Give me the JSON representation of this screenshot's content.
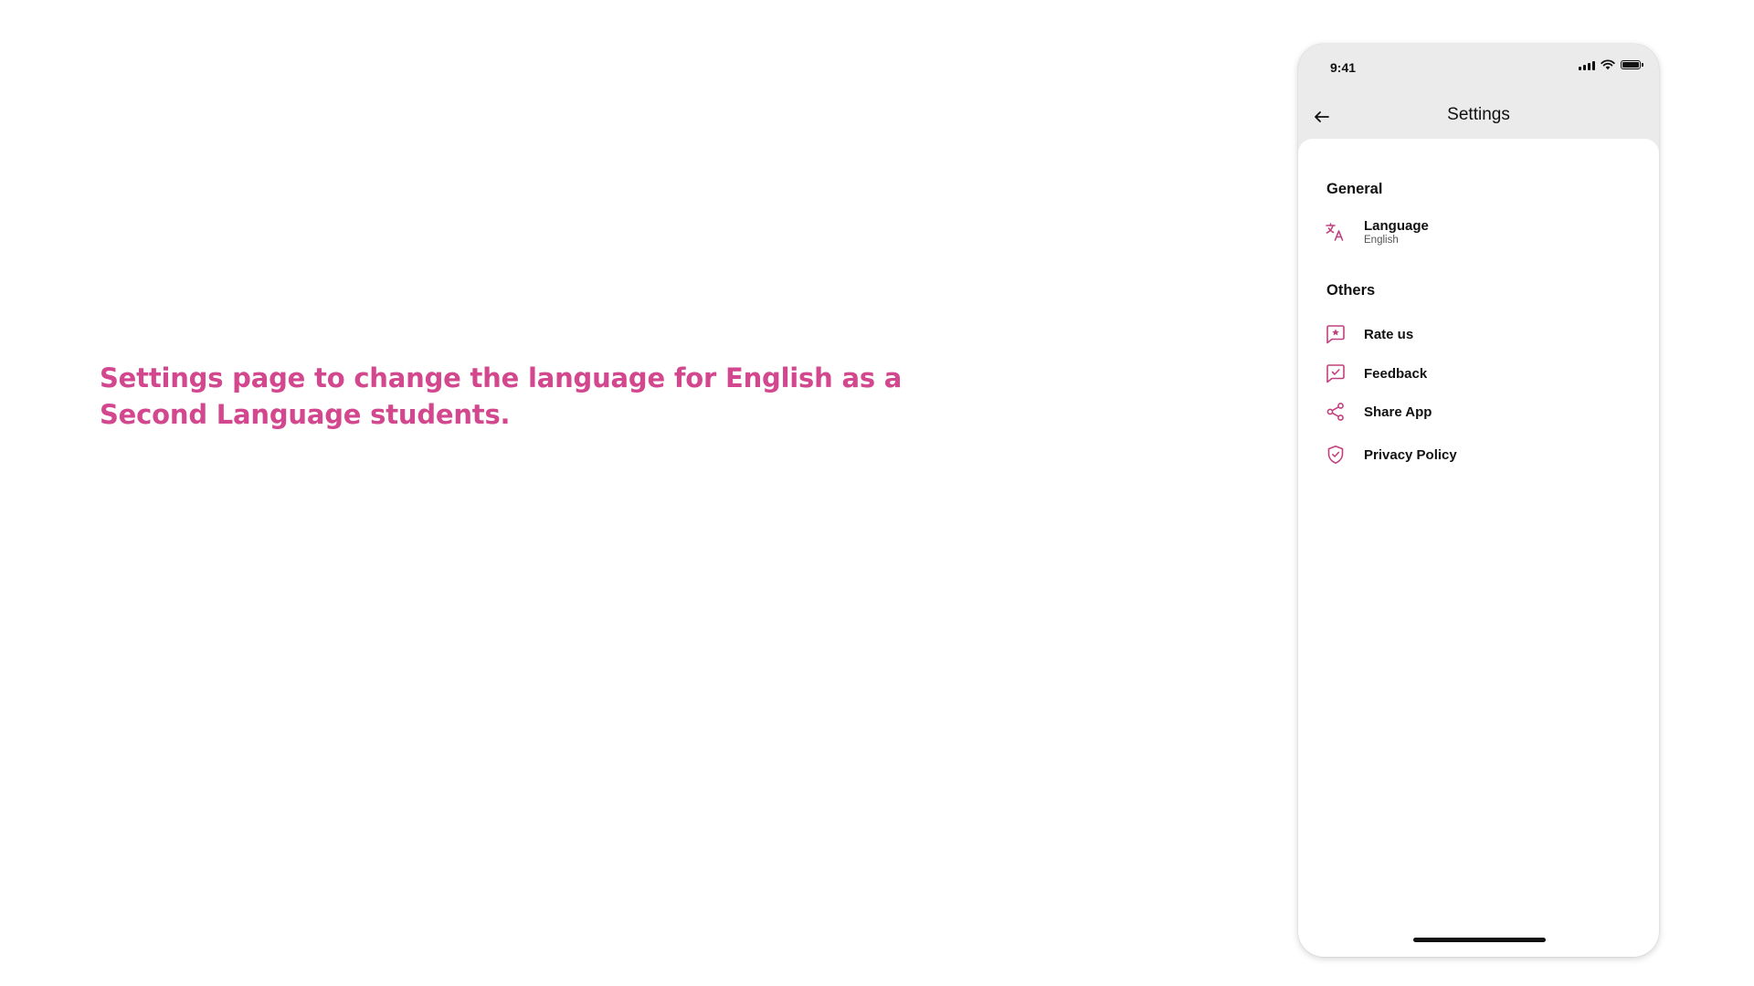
{
  "caption": "Settings page to change the language for English as a Second Language students.",
  "colors": {
    "accent": "#d2478e",
    "icon": "#c2407f",
    "header_bg": "#ebebeb",
    "text": "#111111"
  },
  "phone": {
    "status_bar": {
      "time": "9:41",
      "icons": [
        "signal-icon",
        "wifi-icon",
        "battery-icon"
      ]
    },
    "nav": {
      "back_icon": "arrow-left-icon",
      "title": "Settings"
    },
    "sections": [
      {
        "title": "General",
        "items": [
          {
            "icon": "translate-icon",
            "label": "Language",
            "value": "English"
          }
        ]
      },
      {
        "title": "Others",
        "items": [
          {
            "icon": "star-message-icon",
            "label": "Rate us"
          },
          {
            "icon": "check-message-icon",
            "label": "Feedback"
          },
          {
            "icon": "share-icon",
            "label": "Share App"
          },
          {
            "icon": "shield-check-icon",
            "label": "Privacy Policy"
          }
        ]
      }
    ]
  }
}
